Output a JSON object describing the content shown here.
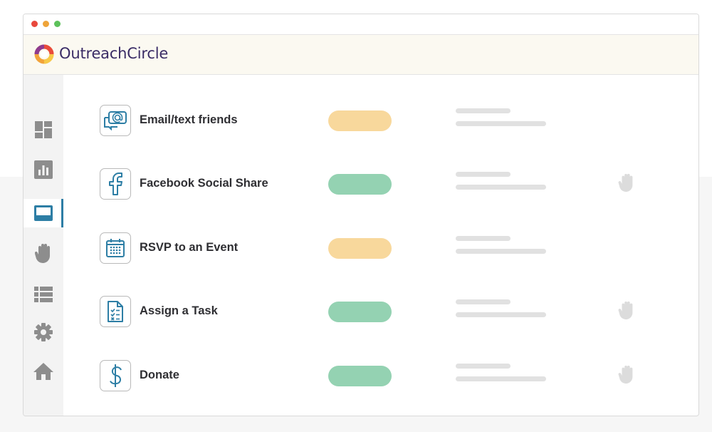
{
  "window": {
    "controls": [
      "close",
      "minimize",
      "maximize"
    ]
  },
  "app": {
    "brand_name": "OutreachCircle",
    "colors": {
      "brand_text": "#3a2c66",
      "accent": "#2d7ea5",
      "pill_orange": "#f8d89c",
      "pill_green": "#94d2b2",
      "header_bg": "#fbf9f1"
    }
  },
  "sidebar": {
    "items": [
      {
        "icon": "dashboard-icon",
        "active": false
      },
      {
        "icon": "bar-chart-icon",
        "active": false
      },
      {
        "icon": "actions-panel-icon",
        "active": true
      },
      {
        "icon": "hand-icon",
        "active": false
      },
      {
        "icon": "list-icon",
        "active": false
      },
      {
        "icon": "gear-icon",
        "active": false
      },
      {
        "icon": "home-icon",
        "active": false
      }
    ]
  },
  "actions": [
    {
      "label": "Email/text friends",
      "icon": "email-chat-icon",
      "status_color": "orange",
      "has_hand": false
    },
    {
      "label": "Facebook Social Share",
      "icon": "facebook-icon",
      "status_color": "green",
      "has_hand": true
    },
    {
      "label": "RSVP to an Event",
      "icon": "calendar-icon",
      "status_color": "orange",
      "has_hand": false
    },
    {
      "label": "Assign a Task",
      "icon": "task-checklist-icon",
      "status_color": "green",
      "has_hand": true
    },
    {
      "label": "Donate",
      "icon": "dollar-icon",
      "status_color": "green",
      "has_hand": true
    }
  ]
}
